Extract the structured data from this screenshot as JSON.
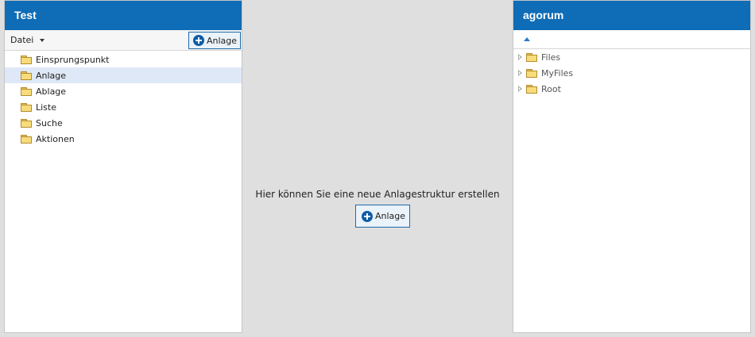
{
  "left_panel": {
    "title": "Test",
    "menu_label": "Datei",
    "add_button_label": "Anlage",
    "tree_items": [
      {
        "label": "Einsprungspunkt",
        "selected": false
      },
      {
        "label": "Anlage",
        "selected": true
      },
      {
        "label": "Ablage",
        "selected": false
      },
      {
        "label": "Liste",
        "selected": false
      },
      {
        "label": "Suche",
        "selected": false
      },
      {
        "label": "Aktionen",
        "selected": false
      }
    ]
  },
  "center": {
    "message": "Hier können Sie eine neue Anlagestruktur erstellen",
    "add_button_label": "Anlage"
  },
  "right_panel": {
    "title": "agorum",
    "tree_items": [
      {
        "label": "Files"
      },
      {
        "label": "MyFiles"
      },
      {
        "label": "Root"
      }
    ]
  },
  "colors": {
    "header_blue": "#0f6cb6",
    "selection": "#dfe8f6",
    "background": "#dfdfdf"
  }
}
